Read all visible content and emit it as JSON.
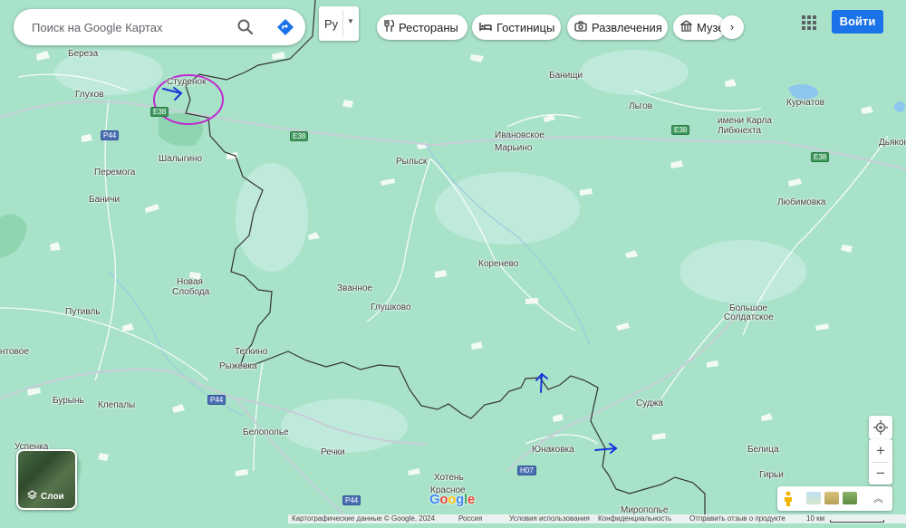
{
  "search": {
    "placeholder": "Поиск на Google Картах"
  },
  "language": {
    "value": "Ру"
  },
  "chips": [
    {
      "label": "Рестораны",
      "icon": "fork-knife-icon"
    },
    {
      "label": "Гостиницы",
      "icon": "bed-icon"
    },
    {
      "label": "Развлечения",
      "icon": "camera-icon"
    },
    {
      "label": "Музе",
      "icon": "museum-icon"
    }
  ],
  "header": {
    "signin_label": "Войти"
  },
  "layers": {
    "label": "Слои"
  },
  "logo": {
    "text": "Google"
  },
  "attribution": {
    "map_data": "Картографические данные © Google, 2024",
    "country": "Россия",
    "terms": "Условия использования",
    "privacy": "Конфиденциальность",
    "feedback": "Отправить отзыв о продукте",
    "scale": "10 км"
  },
  "places": {
    "bereza": "Береза",
    "studenok": "Студенок",
    "glukhov": "Глухов",
    "banishchi": "Банищи",
    "lgov": "Льгов",
    "kurchatov": "Курчатов",
    "imeni_karla": "имени Карла",
    "libknekhta": "Либкнехта",
    "dyakonovo": "Дьяконо",
    "ivanovskoe": "Ивановское",
    "marino": "Марьино",
    "rylsk": "Рыльск",
    "peremoga": "Перемога",
    "shalygino": "Шалыгино",
    "banichi": "Баничи",
    "lyubimovka": "Любимовка",
    "korenevo": "Коренево",
    "novaya": "Новая",
    "sloboda": "Слобода",
    "zvannoe": "Званное",
    "glushkovo": "Глушково",
    "putivl": "Путивль",
    "bolshoe": "Большое",
    "soldatskoe": "Солдатское",
    "tetkino": "Теткино",
    "ryzhevka": "Рыжевка",
    "ntovoe": "нтовое",
    "burin": "Бурынь",
    "klepaly": "Клепалы",
    "sudzha": "Суджа",
    "belopolye": "Белополье",
    "uspenka": "Успенка",
    "rechki": "Речки",
    "yunakovka": "Юнаковка",
    "belitsa": "Белица",
    "khoten": "Хотень",
    "krasnoe": "Красное",
    "giri": "Гирьи",
    "miropolye": "Мирополье"
  },
  "routes": {
    "e38_a": "E38",
    "e38_b": "E38",
    "e38_c": "E38",
    "e38_d": "E38",
    "p44_a": "P44",
    "p44_b": "P44",
    "p44_c": "P44",
    "h07": "H07"
  },
  "colors": {
    "land": "#a8e2c9",
    "border": "#333333",
    "annotation_circle": "#c12ad1",
    "annotation_arrow": "#1836d8",
    "water": "#8ec6ee",
    "primary_button": "#1a73e8"
  }
}
